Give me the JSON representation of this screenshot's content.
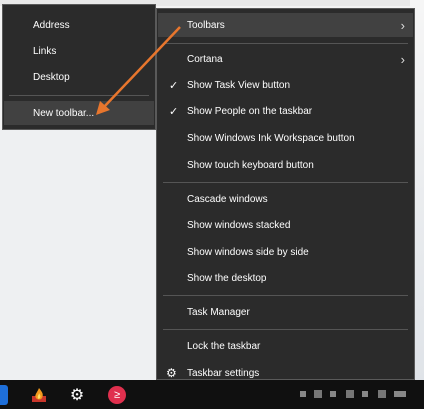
{
  "submenu": {
    "items": [
      {
        "label": "Address"
      },
      {
        "label": "Links"
      },
      {
        "label": "Desktop"
      },
      {
        "label": "New toolbar..."
      }
    ]
  },
  "menu": {
    "items": [
      {
        "label": "Toolbars",
        "submenu": true
      },
      {
        "label": "Cortana",
        "submenu": true
      },
      {
        "label": "Show Task View button",
        "checked": true
      },
      {
        "label": "Show People on the taskbar",
        "checked": true
      },
      {
        "label": "Show Windows Ink Workspace button"
      },
      {
        "label": "Show touch keyboard button"
      },
      {
        "label": "Cascade windows"
      },
      {
        "label": "Show windows stacked"
      },
      {
        "label": "Show windows side by side"
      },
      {
        "label": "Show the desktop"
      },
      {
        "label": "Task Manager"
      },
      {
        "label": "Lock the taskbar"
      },
      {
        "label": "Taskbar settings",
        "icon": "gear-icon"
      }
    ],
    "check_glyph": "✓",
    "arrow_glyph": "›",
    "gear_glyph": "⚙"
  },
  "taskbar": {
    "icons": [
      "task-view-icon",
      "firewall-icon",
      "settings-gear-icon",
      "app-icon"
    ]
  },
  "colors": {
    "menu_bg": "#2b2b2b",
    "menu_highlight": "#414141",
    "annotation_arrow": "#e8762d",
    "taskbar_bg": "#101010"
  }
}
